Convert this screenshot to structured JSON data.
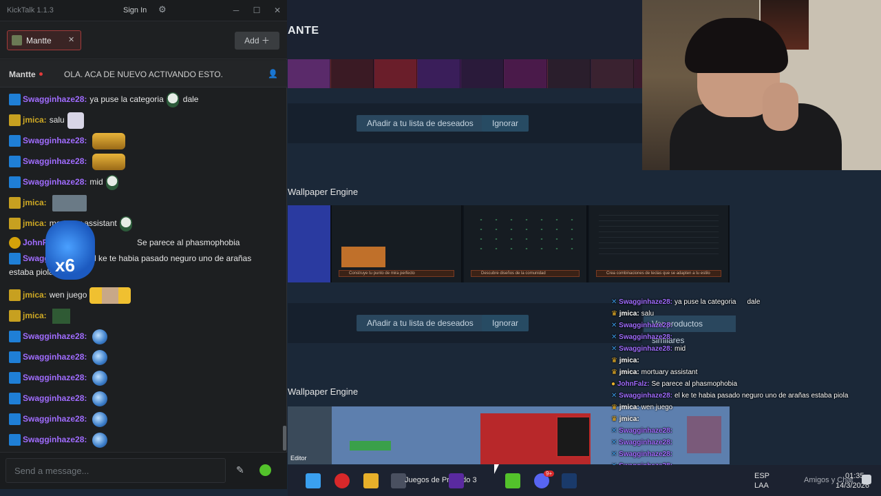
{
  "kicktalk": {
    "app_name": "KickTalk 1.1.3",
    "sign_in": "Sign In",
    "tab_channel": "Mantte",
    "add_label": "Add",
    "pinned_user": "Mantte",
    "pinned_message": "OLA. ACA DE NUEVO ACTIVANDO ESTO.",
    "input_placeholder": "Send a message...",
    "messages": [
      {
        "user": "Swagginhaze28:",
        "text": "ya puse la categoria",
        "text2": "dale"
      },
      {
        "user": "jmica:",
        "text": "salu"
      },
      {
        "user": "Swagginhaze28:",
        "text": ""
      },
      {
        "user": "Swagginhaze28:",
        "text": ""
      },
      {
        "user": "Swagginhaze28:",
        "text": "mid"
      },
      {
        "user": "jmica:",
        "text": ""
      },
      {
        "user": "jmica:",
        "text": "mortuary assistant"
      },
      {
        "user": "JohnFalz:",
        "text": "Se parece al phasmophobia"
      },
      {
        "user": "Swagginhaze28:",
        "text": "el ke te habia pasado neguro uno de arañas",
        "text2": "estaba piola"
      },
      {
        "user": "jmica:",
        "text": "wen juego"
      },
      {
        "user": "jmica:",
        "text": ""
      },
      {
        "user": "Swagginhaze28:",
        "text": ""
      },
      {
        "user": "Swagginhaze28:",
        "text": ""
      },
      {
        "user": "Swagginhaze28:",
        "text": ""
      },
      {
        "user": "Swagginhaze28:",
        "text": ""
      },
      {
        "user": "Swagginhaze28:",
        "text": ""
      },
      {
        "user": "Swagginhaze28:",
        "text": ""
      }
    ]
  },
  "store": {
    "header_title": "ANTE",
    "wishlist_btn": "Añadir a tu lista de deseados",
    "ignore_btn": "Ignorar",
    "section_1": "Wallpaper Engine",
    "section_2": "Wallpaper Engine",
    "similar_btn": "Ver productos similares",
    "caption_1": "Construye tu punto de mira perfecto",
    "caption_2": "Descubre diseños de la comunidad",
    "caption_3": "Crea combinaciones de teclas que se adapten a tu estilo",
    "editor_label": "Editor"
  },
  "overlay_chat": [
    {
      "user": "Swagginhaze28:",
      "text": "ya puse la categoria",
      "text2": "dale"
    },
    {
      "user": "jmica:",
      "text": "salu"
    },
    {
      "user": "Swagginhaze28:",
      "text": ""
    },
    {
      "user": "Swagginhaze28:",
      "text": ""
    },
    {
      "user": "Swagginhaze28:",
      "text": "mid"
    },
    {
      "user": "jmica:",
      "text": ""
    },
    {
      "user": "jmica:",
      "text": "mortuary assistant"
    },
    {
      "user": "JohnFalz:",
      "text": "Se parece al phasmophobia"
    },
    {
      "user": "Swagginhaze28:",
      "text": "el ke te habia pasado neguro uno de arañas estaba piola"
    },
    {
      "user": "jmica:",
      "text": "wen juego"
    },
    {
      "user": "jmica:",
      "text": ""
    },
    {
      "user": "Swagginhaze28:",
      "text": ""
    },
    {
      "user": "Swagginhaze28:",
      "text": ""
    },
    {
      "user": "Swagginhaze28:",
      "text": ""
    },
    {
      "user": "Swagginhaze28:",
      "text": ""
    },
    {
      "user": "Swagginhaze28:",
      "text": ""
    },
    {
      "user": "Swagginhaze28:",
      "text": ""
    }
  ],
  "taskbar": {
    "search_text": "Juegos de Pregado 3",
    "lang_1": "ESP",
    "lang_2": "LAA",
    "time": "01:35",
    "date": "14/3/2026",
    "friends": "Amigos y Chat",
    "discord_badge": "9+"
  },
  "colors": {
    "kick_green": "#53c22b",
    "steam_button": "#2a475e",
    "steam_bg": "#1b2838",
    "name_swagg": "#a06cff",
    "name_jmica": "#d0aa24"
  }
}
